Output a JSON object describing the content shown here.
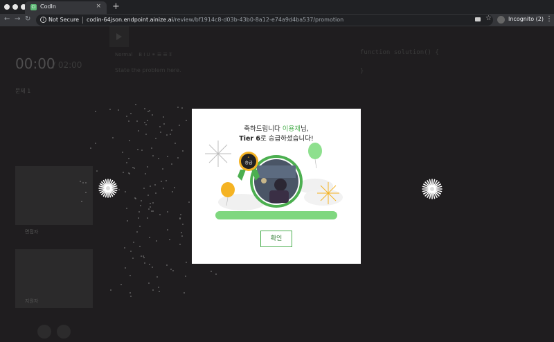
{
  "browser": {
    "tab_title": "CodIn",
    "tab_favicon": "CI",
    "tab_close": "×",
    "new_tab": "+",
    "security_label": "Not Secure",
    "url_host": "codin-64json.endpoint.ainize.ai",
    "url_path": "/review/bf1914c8-d03b-43b0-8a12-e74a9d4ba537/promotion",
    "incognito_label": "Incognito (2)",
    "icons": [
      "back-icon",
      "forward-icon",
      "reload-icon",
      "info-icon",
      "camera-icon",
      "star-icon",
      "incognito-icon",
      "menu-icon"
    ]
  },
  "background": {
    "timer": "00:00",
    "timer_limit": "/ 02:00",
    "problem_label": "문제 1",
    "editor_style": "Normal",
    "editor_tools": "B  I  U  ⚭   ☰  ☰   T̶",
    "problem_placeholder": "State the problem here.",
    "code_line1": "function solution() {",
    "code_line2": "}",
    "participant1": "면접자",
    "participant2": "지원자"
  },
  "modal": {
    "congrats_prefix": "축하드립니다 ",
    "user_name": "이용재",
    "congrats_suffix": "님,",
    "tier": "Tier 6",
    "promotion_text": "로 승급하셨습니다!",
    "badge_label": "승급",
    "confirm_label": "확인",
    "accent_color": "#4caf50"
  }
}
